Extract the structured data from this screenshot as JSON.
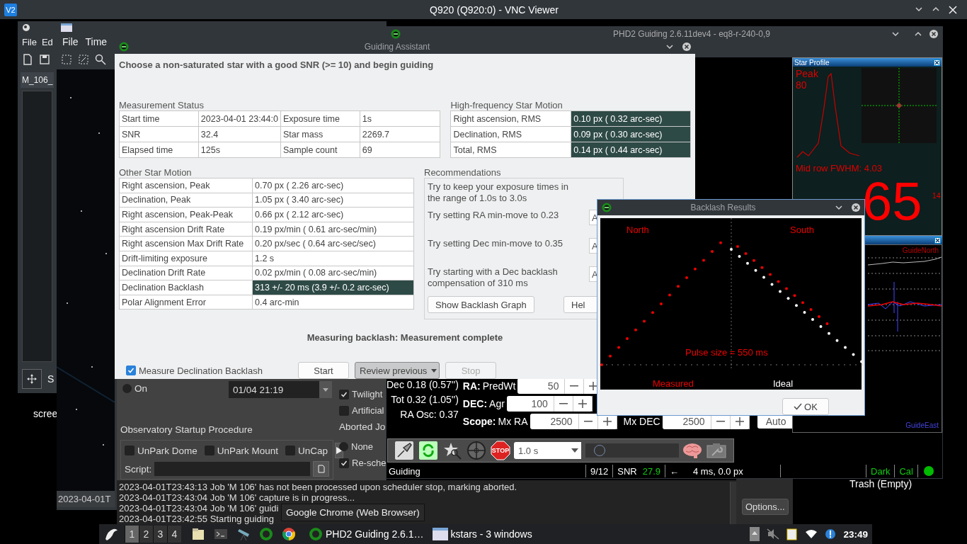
{
  "vnc": {
    "logo": "V2",
    "title": "Q920 (Q920:0) - VNC Viewer"
  },
  "kstars_left": {
    "menu": [
      "File",
      "Ed"
    ],
    "tab": "M_106_",
    "panel_letter": "S"
  },
  "kstars_main": {
    "menu": [
      "File",
      "Time"
    ],
    "image_date": "2023-04-01T"
  },
  "desktop": {
    "screenshot_label": "scree",
    "trash_label": "Trash (Empty)"
  },
  "phd2": {
    "title": "PHD2 Guiding 2.6.11dev4 - eq8-r-240-0,9",
    "star_profile": {
      "title": "Star Profile",
      "peak_label": "Peak",
      "peak_value": "80",
      "fwhm": "Mid row FWHM: 4.03",
      "hfd": "65",
      "hfd_small": "14"
    },
    "graph": {
      "north_label": "GuideNorth",
      "east_label": "GuideEast"
    },
    "stats": [
      "Dec 0.18 (0.57'')",
      "Tot 0.32 (1.05'')",
      "RA Osc: 0.37"
    ],
    "params": [
      {
        "group": "RA:",
        "label": "PredWt",
        "value": "50"
      },
      {
        "group": "DEC:",
        "label": "Agr",
        "value": "100"
      },
      {
        "group": "Scope:",
        "label": "Mx RA",
        "value": "2500"
      },
      {
        "label": "Mx DEC",
        "value": "2500"
      }
    ],
    "mode": "Auto",
    "toolbar": {
      "stop_label": "STOP",
      "exposure": "1.0 s",
      "level": 0.15
    },
    "status": {
      "state": "Guiding",
      "frames": "9/12",
      "snr_label": "SNR",
      "snr": "27.9",
      "arrow": "←",
      "pulse": "4 ms, 0.0 px",
      "dark": "Dark",
      "cal": "Cal"
    }
  },
  "guiding_assistant": {
    "title": "Guiding Assistant",
    "instruction": "Choose a non-saturated star with a good SNR (>= 10) and begin guiding",
    "measurement": {
      "title": "Measurement Status",
      "rows": [
        [
          "Start time",
          "2023-04-01 23:44:0",
          "Exposure time",
          "1s"
        ],
        [
          "SNR",
          "32.4",
          "Star mass",
          "2269.7"
        ],
        [
          "Elapsed time",
          "125s",
          "Sample count",
          "69"
        ]
      ]
    },
    "high_frequency": {
      "title": "High-frequency Star Motion",
      "rows": [
        {
          "label": "Right ascension, RMS",
          "value": "0.10 px ( 0.32 arc-sec)"
        },
        {
          "label": "Declination, RMS",
          "value": "0.09 px ( 0.30 arc-sec)"
        },
        {
          "label": "Total, RMS",
          "value": "0.14 px ( 0.44 arc-sec)"
        }
      ]
    },
    "other": {
      "title": "Other Star Motion",
      "rows": [
        {
          "label": "Right ascension, Peak",
          "value": "0.70 px ( 2.26 arc-sec)",
          "highlighted": false
        },
        {
          "label": "Declination, Peak",
          "value": "1.05 px ( 3.40 arc-sec)",
          "highlighted": false
        },
        {
          "label": "Right ascension, Peak-Peak",
          "value": "0.66 px ( 2.12 arc-sec)",
          "highlighted": false
        },
        {
          "label": "Right ascension Drift Rate",
          "value": "0.19 px/min ( 0.61 arc-sec/min)",
          "highlighted": false
        },
        {
          "label": "Right ascension Max Drift Rate",
          "value": "0.20 px/sec ( 0.64 arc-sec/sec)",
          "highlighted": false
        },
        {
          "label": "Drift-limiting exposure",
          "value": "1.2 s",
          "highlighted": false
        },
        {
          "label": "Declination Drift Rate",
          "value": "0.02 px/min ( 0.08 arc-sec/min)",
          "highlighted": false
        },
        {
          "label": "Declination Backlash",
          "value": "313  +/-  20 ms (3.9  +/-  0.2 arc-sec)",
          "highlighted": true
        },
        {
          "label": "Polar Alignment Error",
          "value": "0.4 arc-min",
          "highlighted": false
        }
      ]
    },
    "recommendations": {
      "title": "Recommendations",
      "items": [
        {
          "text": "Try to keep your exposure times in the range of 1.0s to 3.0s"
        },
        {
          "text": "Try setting RA min-move to 0.23",
          "button": "A"
        },
        {
          "text": "Try setting Dec min-move to 0.35",
          "button": "A"
        },
        {
          "text": "Try starting with a Dec backlash compensation of 310 ms",
          "button": "A"
        }
      ],
      "buttons": [
        "Show Backlash Graph",
        "Hel"
      ]
    },
    "status": "Measuring backlash: Measurement complete",
    "measure_backlash": {
      "label": "Measure Declination Backlash",
      "checked": true
    },
    "buttons": [
      {
        "label": "Start",
        "kind": "push",
        "disabled": false
      },
      {
        "label": "Review previous",
        "kind": "dropdown",
        "disabled": false
      },
      {
        "label": "Stop",
        "kind": "push",
        "disabled": true
      }
    ]
  },
  "backlash_results": {
    "title": "Backlash Results",
    "north": "North",
    "south": "South",
    "pulse": "Pulse size = 550 ms",
    "measured": "Measured",
    "ideal": "Ideal",
    "ok": "OK"
  },
  "scheduler": {
    "on": {
      "label": "On",
      "selected": false
    },
    "date": "01/04 21:19",
    "twilight": {
      "label": "Twilight",
      "checked": true
    },
    "artificial": {
      "label": "Artificial",
      "checked": false
    },
    "startup_title": "Observatory Startup Procedure",
    "startup": [
      {
        "label": "UnPark Dome",
        "checked": false
      },
      {
        "label": "UnPark Mount",
        "checked": false
      },
      {
        "label": "UnCap",
        "checked": false
      }
    ],
    "script_label": "Script:",
    "aborted_title": "Aborted Jo",
    "none": {
      "label": "None",
      "selected": false
    },
    "reschedule": {
      "label": "Re-sche",
      "checked": true
    }
  },
  "log": [
    "2023-04-01T23:43:13 Job 'M 106' has not been processed upon scheduler stop, marking aborted.",
    "2023-04-01T23:43:04 Job 'M 106' capture is in progress...",
    "2023-04-01T23:43:04 Job 'M 106' guidi",
    "2023-04-01T23:42:55 Starting guiding"
  ],
  "options_button": "Options...",
  "taskbar": {
    "pager": [
      {
        "label": "1",
        "selected": true
      },
      {
        "label": "2",
        "selected": false
      },
      {
        "label": "3",
        "selected": false
      },
      {
        "label": "4",
        "selected": false
      }
    ],
    "tasks": [
      {
        "label": "PHD2 Guiding 2.6.1…",
        "kind": "phd2"
      },
      {
        "label": "kstars - 3 windows",
        "kind": "kstars"
      }
    ],
    "clock": "23:49",
    "tooltip": "Google Chrome (Web Browser)"
  }
}
